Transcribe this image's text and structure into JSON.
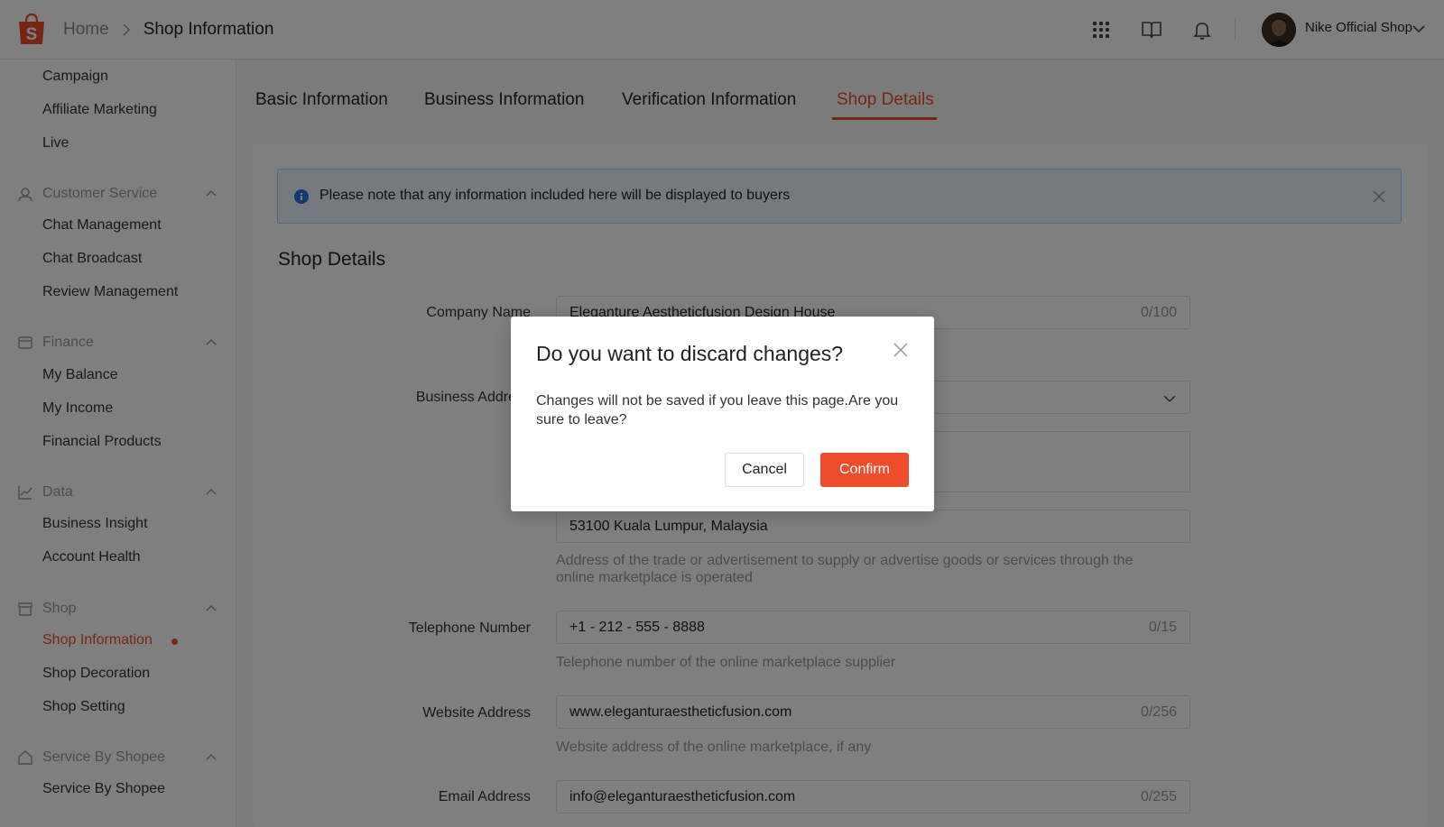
{
  "header": {
    "breadcrumb": {
      "home": "Home",
      "current": "Shop Information"
    },
    "icons": [
      "apps-grid-icon",
      "book-icon",
      "bell-icon"
    ],
    "shop_name": "Nike Official Shop"
  },
  "sidebar": {
    "top_items": [
      "Campaign",
      "Affiliate Marketing",
      "Live"
    ],
    "sections": [
      {
        "title": "Customer Service",
        "icon": "headset-icon",
        "items": [
          "Chat Management",
          "Chat Broadcast",
          "Review Management"
        ]
      },
      {
        "title": "Finance",
        "icon": "wallet-icon",
        "items": [
          "My Balance",
          "My Income",
          "Financial Products"
        ]
      },
      {
        "title": "Data",
        "icon": "chart-icon",
        "items": [
          "Business Insight",
          "Account Health"
        ]
      },
      {
        "title": "Shop",
        "icon": "store-icon",
        "items": [
          "Shop Information",
          "Shop Decoration",
          "Shop Setting"
        ]
      },
      {
        "title": "Service By Shopee",
        "icon": "home-icon",
        "items": [
          "Service By Shopee"
        ]
      }
    ],
    "active_item": "Shop Information"
  },
  "tabs": [
    "Basic Information",
    "Business Information",
    "Verification Information",
    "Shop Details"
  ],
  "active_tab": "Shop Details",
  "notice": "Please note that any information included here will be displayed to buyers",
  "section_title": "Shop Details",
  "form": {
    "company_name": {
      "label": "Company Name",
      "value": "Eleganture Aestheticfusion Design House",
      "counter": "0/100"
    },
    "business_address": {
      "label": "Business Address",
      "address_line": "53100 Kuala Lumpur, Malaysia",
      "help": "Address of the trade or advertisement to supply or advertise goods or services through the online marketplace is operated"
    },
    "telephone": {
      "label": "Telephone Number",
      "value": "+1 - 212 - 555 - 8888",
      "counter": "0/15",
      "help": "Telephone number of the online marketplace supplier"
    },
    "website": {
      "label": "Website Address",
      "value": "www.eleganturaestheticfusion.com",
      "counter": "0/256",
      "help": "Website address of the online marketplace, if any"
    },
    "email": {
      "label": "Email Address",
      "value": "info@eleganturaestheticfusion.com",
      "counter": "0/255"
    }
  },
  "modal": {
    "title": "Do you want to discard changes?",
    "body": "Changes will not be saved if you leave this page.Are you sure to leave?",
    "cancel_label": "Cancel",
    "confirm_label": "Confirm"
  },
  "colors": {
    "brand": "#ee4d2d",
    "notice_bg": "#eaf4ff",
    "notice_border": "#a8d0ff"
  }
}
